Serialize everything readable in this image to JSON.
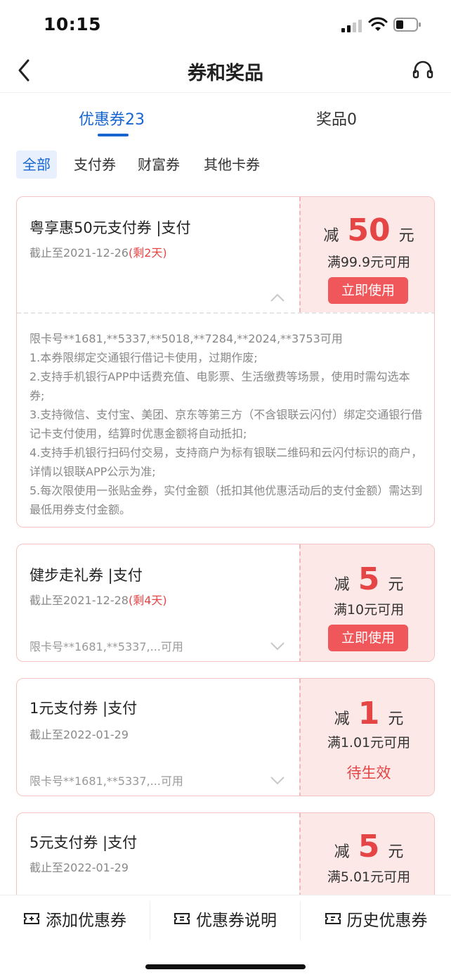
{
  "status": {
    "time": "10:15"
  },
  "nav": {
    "title": "券和奖品"
  },
  "tabs": [
    {
      "label": "优惠券23"
    },
    {
      "label": "奖品0"
    }
  ],
  "filters": [
    {
      "label": "全部"
    },
    {
      "label": "支付券"
    },
    {
      "label": "财富券"
    },
    {
      "label": "其他卡券"
    }
  ],
  "coupons": [
    {
      "title": "粤享惠50元支付券 |支付",
      "date": "截止至2021-12-26",
      "remain": "(剩2天)",
      "prefix": "减",
      "amount": "50",
      "unit": "元",
      "min": "满99.9元可用",
      "action": "立即使用",
      "details": [
        "限卡号**1681,**5337,**5018,**7284,**2024,**3753可用",
        "1.本券限绑定交通银行借记卡使用，过期作废;",
        "2.支持手机银行APP中话费充值、电影票、生活缴费等场景，使用时需勾选本券;",
        "3.支持微信、支付宝、美团、京东等第三方（不含银联云闪付）绑定交通银行借记卡支付使用，结算时优惠金额将自动抵扣;",
        "4.支持手机银行扫码付交易，支持商户为标有银联二维码和云闪付标识的商户，详情以银联APP公示为准;",
        "5.每次限使用一张贴金券，实付金额（抵扣其他优惠活动后的支付金额）需达到最低用券支付金额。"
      ]
    },
    {
      "title": "健步走礼券 |支付",
      "date": "截止至2021-12-28",
      "remain": "(剩4天)",
      "cards": "限卡号**1681,**5337,...可用",
      "prefix": "减",
      "amount": "5",
      "unit": "元",
      "min": "满10元可用",
      "action": "立即使用"
    },
    {
      "title": "1元支付券 |支付",
      "date": "截止至2022-01-29",
      "cards": "限卡号**1681,**5337,...可用",
      "prefix": "减",
      "amount": "1",
      "unit": "元",
      "min": "满1.01元可用",
      "status": "待生效"
    },
    {
      "title": "5元支付券 |支付",
      "date": "截止至2022-01-29",
      "prefix": "减",
      "amount": "5",
      "unit": "元",
      "min": "满5.01元可用"
    }
  ],
  "bottom": [
    {
      "label": "添加优惠券"
    },
    {
      "label": "优惠券说明"
    },
    {
      "label": "历史优惠券"
    }
  ],
  "colors": {
    "accent_blue": "#1766d1",
    "accent_red": "#e54545",
    "button_red": "#f0575a",
    "coupon_right_bg": "#fde8e8"
  }
}
